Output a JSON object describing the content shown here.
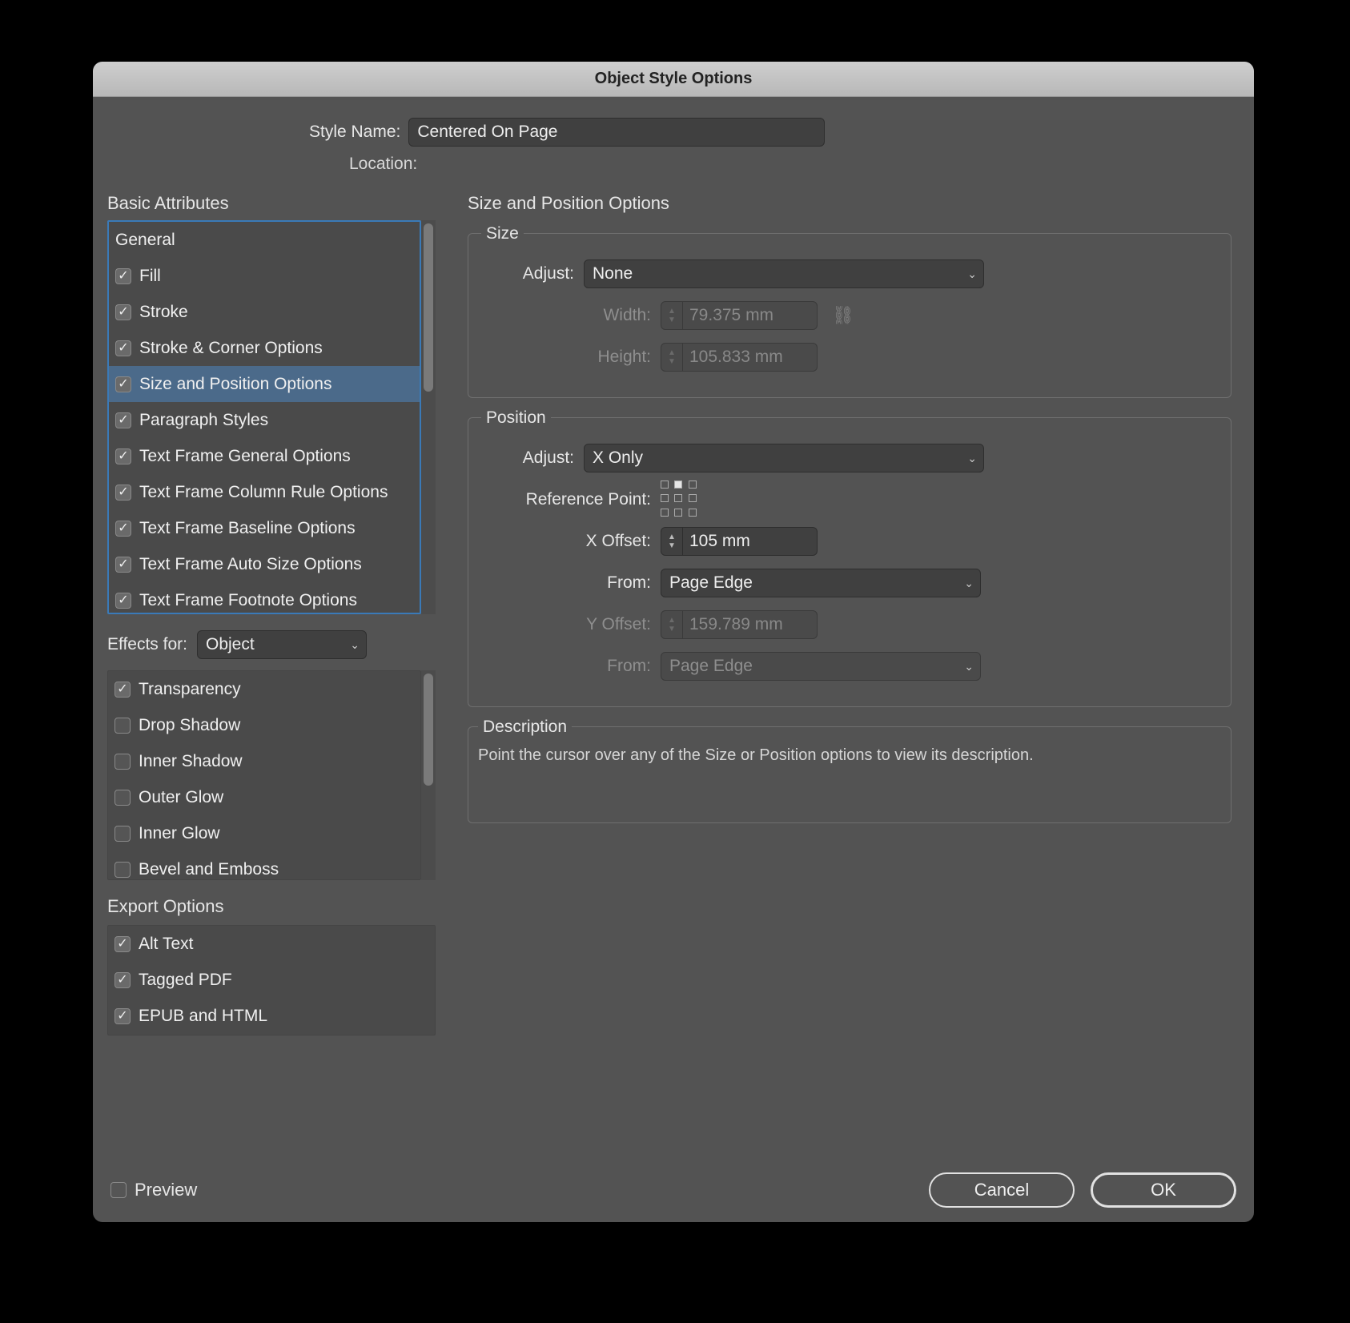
{
  "window": {
    "title": "Object Style Options"
  },
  "header": {
    "style_name_label": "Style Name:",
    "style_name_value": "Centered On Page",
    "location_label": "Location:"
  },
  "left": {
    "basic_attributes_label": "Basic Attributes",
    "basic_items": [
      {
        "label": "General",
        "checked": null,
        "selected": false
      },
      {
        "label": "Fill",
        "checked": true,
        "selected": false
      },
      {
        "label": "Stroke",
        "checked": true,
        "selected": false
      },
      {
        "label": "Stroke & Corner Options",
        "checked": true,
        "selected": false
      },
      {
        "label": "Size and Position Options",
        "checked": true,
        "selected": true
      },
      {
        "label": "Paragraph Styles",
        "checked": true,
        "selected": false
      },
      {
        "label": "Text Frame General Options",
        "checked": true,
        "selected": false
      },
      {
        "label": "Text Frame Column Rule Options",
        "checked": true,
        "selected": false
      },
      {
        "label": "Text Frame Baseline Options",
        "checked": true,
        "selected": false
      },
      {
        "label": "Text Frame Auto Size Options",
        "checked": true,
        "selected": false
      },
      {
        "label": "Text Frame Footnote Options",
        "checked": true,
        "selected": false
      }
    ],
    "effects_for_label": "Effects for:",
    "effects_for_value": "Object",
    "effects_items": [
      {
        "label": "Transparency",
        "checked": true
      },
      {
        "label": "Drop Shadow",
        "checked": false
      },
      {
        "label": "Inner Shadow",
        "checked": false
      },
      {
        "label": "Outer Glow",
        "checked": false
      },
      {
        "label": "Inner Glow",
        "checked": false
      },
      {
        "label": "Bevel and Emboss",
        "checked": false
      }
    ],
    "export_label": "Export Options",
    "export_items": [
      {
        "label": "Alt Text",
        "checked": true
      },
      {
        "label": "Tagged PDF",
        "checked": true
      },
      {
        "label": "EPUB and HTML",
        "checked": true
      }
    ]
  },
  "right": {
    "panel_title": "Size and Position Options",
    "size": {
      "legend": "Size",
      "adjust_label": "Adjust:",
      "adjust_value": "None",
      "width_label": "Width:",
      "width_value": "79.375 mm",
      "height_label": "Height:",
      "height_value": "105.833 mm"
    },
    "position": {
      "legend": "Position",
      "adjust_label": "Adjust:",
      "adjust_value": "X Only",
      "refpoint_label": "Reference Point:",
      "xoffset_label": "X Offset:",
      "xoffset_value": "105 mm",
      "xfrom_label": "From:",
      "xfrom_value": "Page Edge",
      "yoffset_label": "Y Offset:",
      "yoffset_value": "159.789 mm",
      "yfrom_label": "From:",
      "yfrom_value": "Page Edge"
    },
    "description": {
      "legend": "Description",
      "text": "Point the cursor over any of the Size or Position options to view its description."
    }
  },
  "footer": {
    "preview_label": "Preview",
    "cancel_label": "Cancel",
    "ok_label": "OK"
  }
}
